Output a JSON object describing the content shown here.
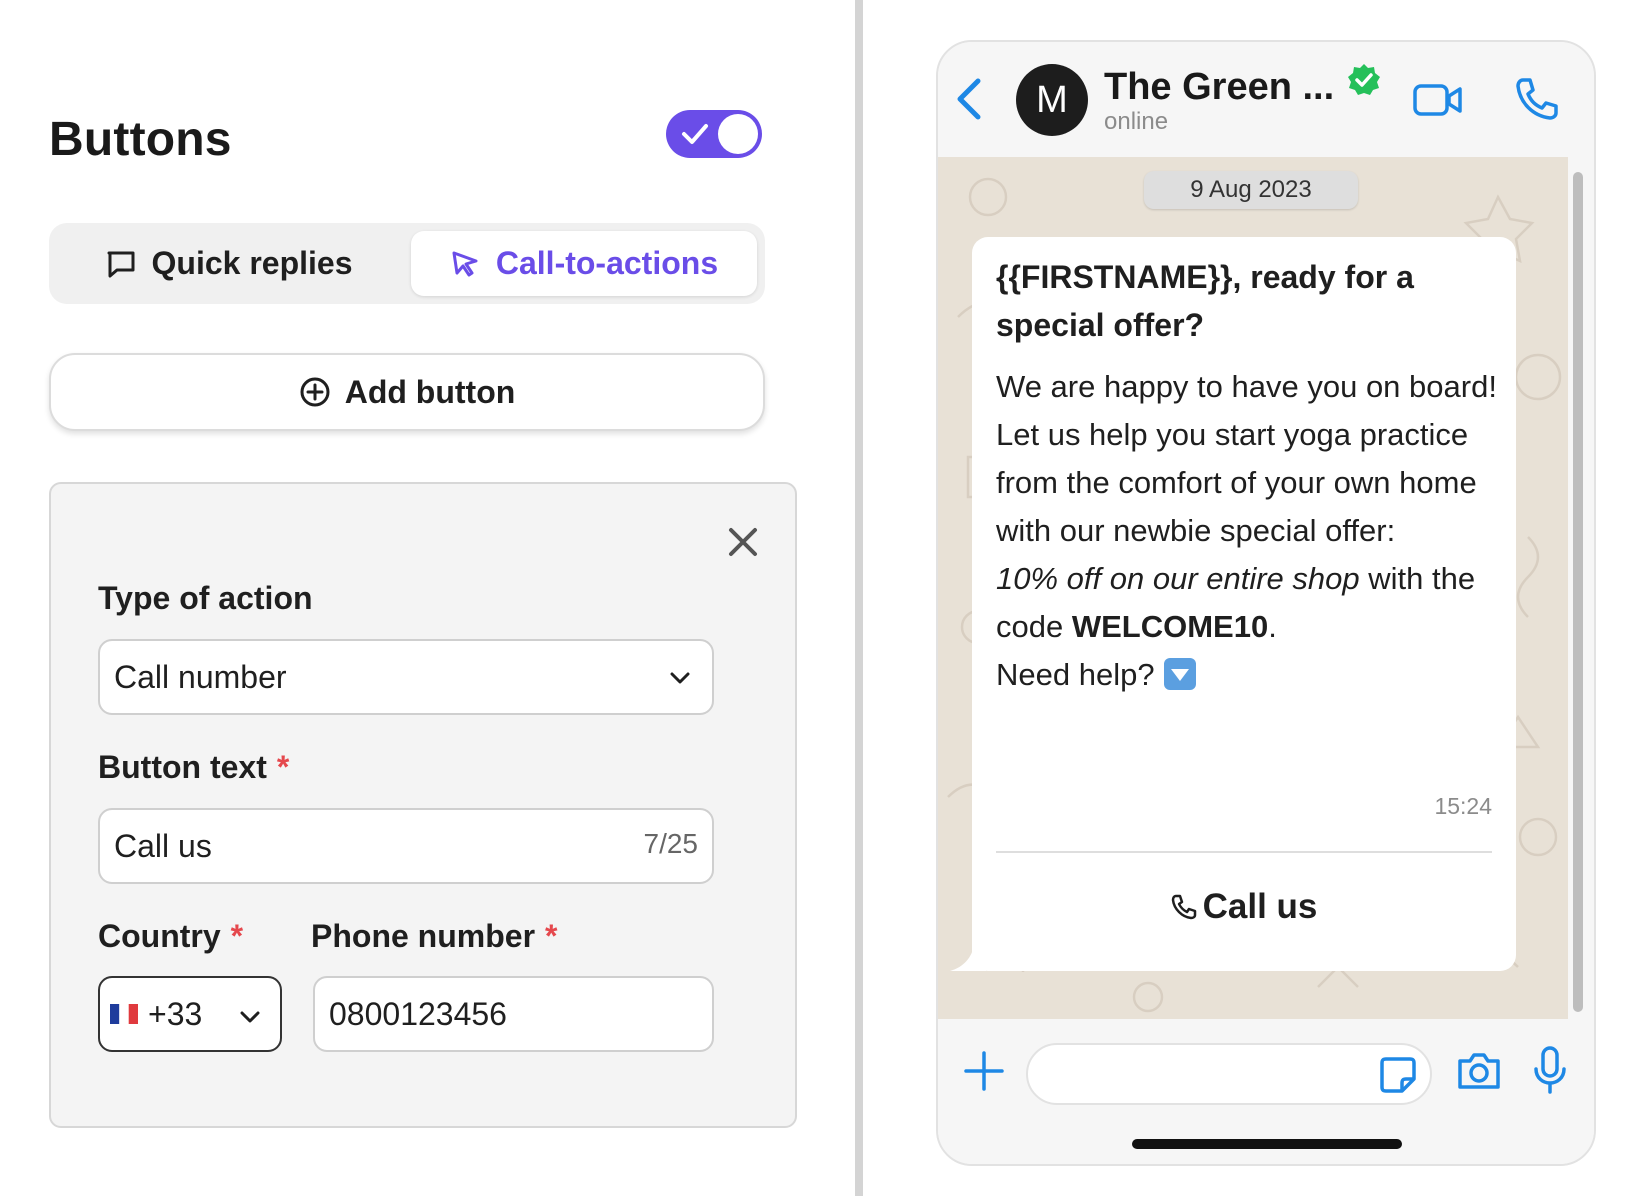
{
  "editor": {
    "title": "Buttons",
    "toggle_on": true,
    "tabs": {
      "quick_replies": "Quick replies",
      "call_to_actions": "Call-to-actions"
    },
    "add_button_label": "Add button",
    "form": {
      "type_of_action_label": "Type of action",
      "type_of_action_value": "Call number",
      "button_text_label": "Button text",
      "button_text_value": "Call us",
      "button_text_counter": "7/25",
      "country_label": "Country",
      "country_value": "+33",
      "phone_label": "Phone number",
      "phone_value": "0800123456",
      "required_mark": "*"
    }
  },
  "preview": {
    "contact_initial": "M",
    "contact_name": "The Green ...",
    "contact_status": "online",
    "date": "9 Aug 2023",
    "message": {
      "title": "{{FIRSTNAME}}, ready for a special offer?",
      "p1": "We are happy to have you on board!",
      "p2": "Let us help you start yoga practice from the comfort of your own home with our newbie special offer:",
      "offer_italic": "10% off on our entire shop",
      "offer_with": " with the code ",
      "code": "WELCOME10",
      "offer_end": ".",
      "help": "Need help? ",
      "time": "15:24",
      "button_label": "Call us"
    }
  },
  "colors": {
    "accent": "#6a4de8",
    "ios_blue": "#1e88e5",
    "verified_green": "#25c05a",
    "required_red": "#e5484d"
  }
}
